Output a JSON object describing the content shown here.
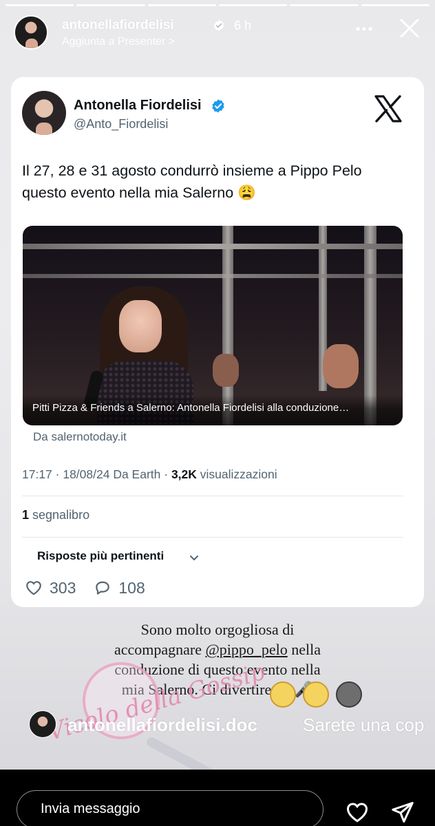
{
  "story": {
    "username": "antonellafiordelisi",
    "time": "6 h",
    "subtitle": "Aggiunta a Presenter >",
    "progress_segments": 6
  },
  "tweet": {
    "display_name": "Antonella Fiordelisi",
    "handle": "@Anto_Fiordelisi",
    "text_line1": "Il 27, 28 e 31 agosto condurrò insieme a Pippo Pelo",
    "text_line2": "questo evento nella mia Salerno 😩",
    "media_caption": "Pitti Pizza & Friends a Salerno: Antonella Fiordelisi alla conduzione…",
    "source": "Da salernotoday.it",
    "meta_prefix": "17:17 · 18/08/24 Da Earth · ",
    "views_count": "3,2K",
    "views_label": " visualizzazioni",
    "bookmarks_count": "1",
    "bookmarks_label": " segnalibro",
    "sort_label": "Risposte più pertinenti",
    "likes": "303",
    "replies": "108"
  },
  "caption": {
    "line1": "Sono molto orgogliosa di",
    "line2_prefix": "accompagnare ",
    "mention": "@pippo_pelo",
    "line2_suffix": " nella",
    "line3": "conduzione di questo evento nella",
    "line4": "mia Salerno. Ci divertiremo 🎤"
  },
  "sticker": {
    "text": "Vicolo della Gossip"
  },
  "comment": {
    "user": "antonellafiordelisi.doc",
    "text": "Sarete una cop"
  },
  "bottom": {
    "message_placeholder": "Invia messaggio"
  },
  "colors": {
    "verified": "#1d9bf0",
    "text_primary": "#0f1419",
    "text_secondary": "#536471"
  }
}
